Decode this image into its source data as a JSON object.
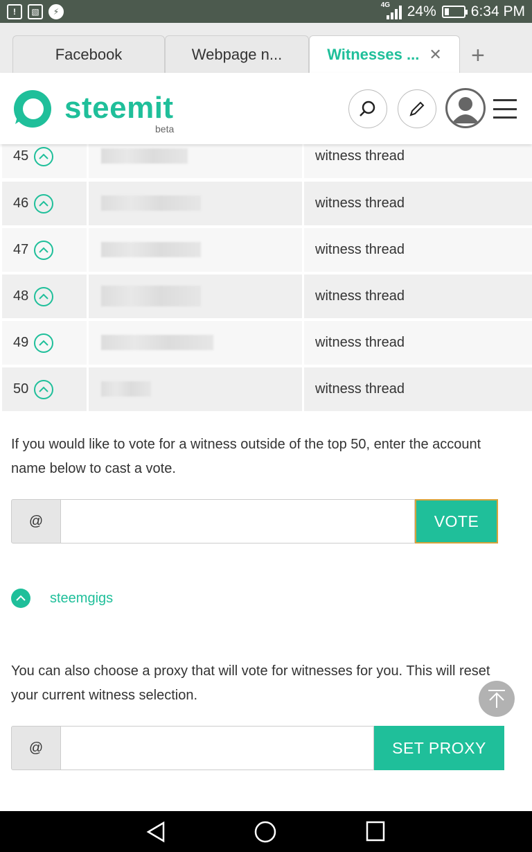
{
  "status_bar": {
    "network": "4G",
    "battery": "24%",
    "time": "6:34 PM",
    "battery_level": 0.24
  },
  "tabs": [
    {
      "label": "Facebook"
    },
    {
      "label": "Webpage n..."
    },
    {
      "label": "Witnesses ...",
      "active": true
    }
  ],
  "header": {
    "logo_text": "steemit",
    "logo_beta": "beta"
  },
  "witnesses": [
    {
      "rank": "45",
      "thread": "witness thread"
    },
    {
      "rank": "46",
      "thread": "witness thread"
    },
    {
      "rank": "47",
      "thread": "witness thread"
    },
    {
      "rank": "48",
      "thread": "witness thread"
    },
    {
      "rank": "49",
      "thread": "witness thread"
    },
    {
      "rank": "50",
      "thread": "witness thread"
    }
  ],
  "vote_section": {
    "description": "If you would like to vote for a witness outside of the top 50, enter the account name below to cast a vote.",
    "at": "@",
    "input_value": "",
    "button": "VOTE"
  },
  "voted_account": "steemgigs",
  "proxy_section": {
    "description": "You can also choose a proxy that will vote for witnesses for you. This will reset your current witness selection.",
    "at": "@",
    "input_value": "",
    "button": "SET PROXY"
  },
  "colors": {
    "accent": "#1fbf9a",
    "status_bar": "#4c5a4e",
    "vote_border": "#d7a23a"
  }
}
